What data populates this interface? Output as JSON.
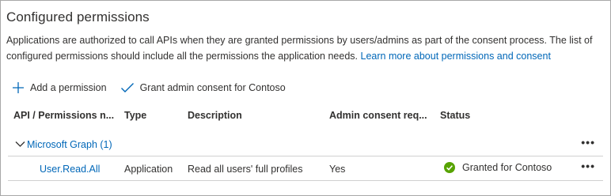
{
  "section": {
    "title": "Configured permissions",
    "description": "Applications are authorized to call APIs when they are granted permissions by users/admins as part of the consent process. The list of configured permissions should include all the permissions the application needs.",
    "learn_more_link": "Learn more about permissions and consent"
  },
  "toolbar": {
    "add_permission_label": "Add a permission",
    "grant_consent_label": "Grant admin consent for Contoso"
  },
  "table": {
    "columns": [
      "API / Permissions n...",
      "Type",
      "Description",
      "Admin consent req...",
      "Status"
    ],
    "group": {
      "name": "Microsoft Graph (1)",
      "more": "•••"
    },
    "rows": [
      {
        "permission": "User.Read.All",
        "type": "Application",
        "description": "Read all users' full profiles",
        "admin_consent": "Yes",
        "status": "Granted for Contoso",
        "more": "•••"
      }
    ]
  },
  "colors": {
    "link": "#0067b8",
    "success": "#57a300"
  }
}
